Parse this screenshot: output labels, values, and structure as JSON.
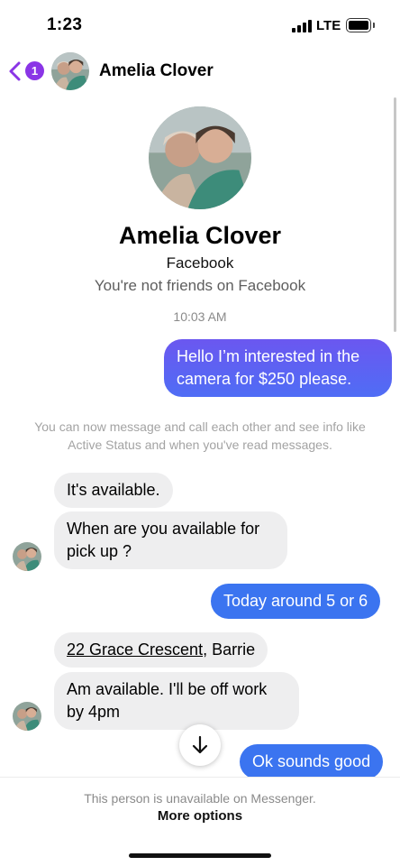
{
  "status_bar": {
    "time": "1:23",
    "network": "LTE",
    "battery_level": 1.0
  },
  "header": {
    "back_badge": "1",
    "title": "Amelia Clover",
    "accent": "#8a35e6"
  },
  "profile": {
    "name": "Amelia Clover",
    "platform": "Facebook",
    "relation": "You're not friends on Facebook"
  },
  "timestamp": "10:03 AM",
  "messages": {
    "m1": "Hello I’m interested in the camera for $250 please.",
    "system": "You can now message and call each other and see info like Active Status and when you've read messages.",
    "m2": "It's available.",
    "m3": "When are you available for pick up ?",
    "m4": "Today around 5 or 6",
    "m5_link": "22 Grace Crescent",
    "m5_rest": ", Barrie",
    "m6": "Am available. I'll be off work by 4pm",
    "m7": "Ok sounds good"
  },
  "footer": {
    "unavailable": "This person is unavailable on Messenger.",
    "more_options": "More options"
  },
  "colors": {
    "outgoing_gradient_top": "#6b57f0",
    "outgoing_blue": "#3b74f0",
    "incoming_bg": "#eeeeef"
  }
}
